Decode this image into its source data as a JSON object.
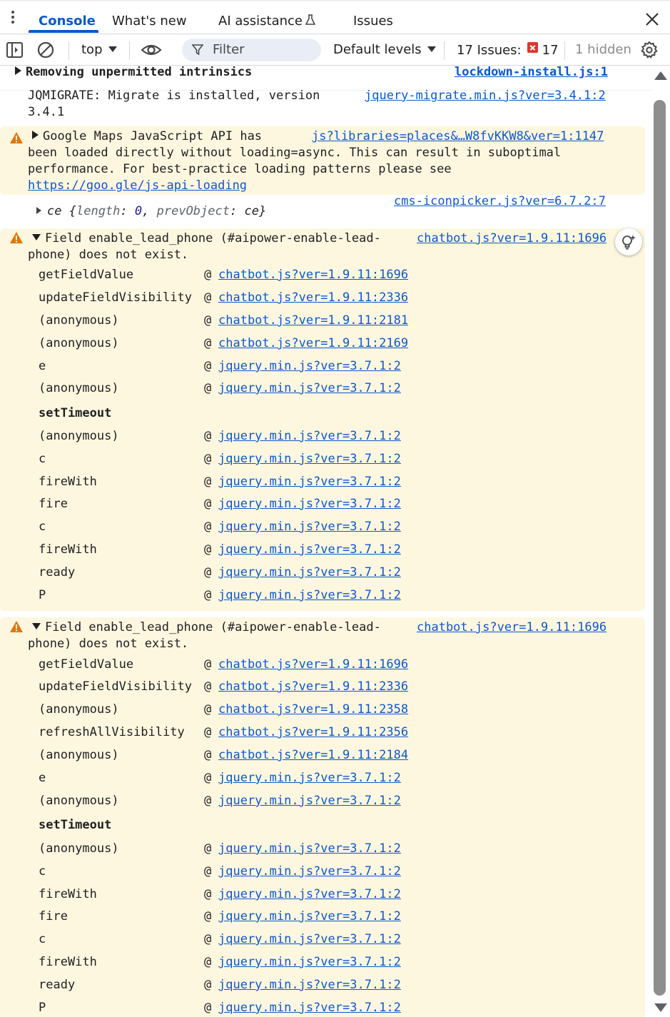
{
  "tabs": [
    {
      "label": "Console",
      "active": true
    },
    {
      "label": "What's new"
    },
    {
      "label": "AI assistance"
    },
    {
      "label": "Issues"
    }
  ],
  "toolbar": {
    "context": "top",
    "filter_placeholder": "Filter",
    "levels": "Default levels",
    "issues_label": "17 Issues:",
    "issues_count": "17",
    "hidden": "1 hidden"
  },
  "messages": {
    "m1": {
      "text": "Removing unpermitted intrinsics",
      "source": "lockdown-install.js:1"
    },
    "m2": {
      "line1": "JQMIGRATE: Migrate is installed, version",
      "line2": "3.4.1",
      "source": "jquery-migrate.min.js?ver=3.4.1:2"
    },
    "m3": {
      "line1": "Google Maps JavaScript API has",
      "line2": "been loaded directly without loading=async. This can result in suboptimal",
      "line3": "performance. For best-practice loading patterns please see",
      "link": "https://goo.gle/js-api-loading",
      "source": "js?libraries=places&…W8fvKKW8&ver=1:1147"
    },
    "m4": {
      "obj": "ce",
      "open": "{",
      "k1": "length",
      "v1": "0",
      "k2": "prevObject",
      "v2": "ce",
      "close": "}",
      "source": "cms-iconpicker.js?ver=6.7.2:7"
    },
    "m5": {
      "line1": "Field enable_lead_phone (#aipower-enable-lead-",
      "line2": "phone) does not exist.",
      "source": "chatbot.js?ver=1.9.11:1696",
      "frames_a": [
        {
          "name": "getFieldValue",
          "link": "chatbot.js?ver=1.9.11:1696"
        },
        {
          "name": "updateFieldVisibility",
          "link": "chatbot.js?ver=1.9.11:2336"
        },
        {
          "name": "(anonymous)",
          "link": "chatbot.js?ver=1.9.11:2181"
        },
        {
          "name": "(anonymous)",
          "link": "chatbot.js?ver=1.9.11:2169"
        },
        {
          "name": "e",
          "link": "jquery.min.js?ver=3.7.1:2"
        },
        {
          "name": "(anonymous)",
          "link": "jquery.min.js?ver=3.7.1:2"
        }
      ],
      "async_label": "setTimeout",
      "frames_b": [
        {
          "name": "(anonymous)",
          "link": "jquery.min.js?ver=3.7.1:2"
        },
        {
          "name": "c",
          "link": "jquery.min.js?ver=3.7.1:2"
        },
        {
          "name": "fireWith",
          "link": "jquery.min.js?ver=3.7.1:2"
        },
        {
          "name": "fire",
          "link": "jquery.min.js?ver=3.7.1:2"
        },
        {
          "name": "c",
          "link": "jquery.min.js?ver=3.7.1:2"
        },
        {
          "name": "fireWith",
          "link": "jquery.min.js?ver=3.7.1:2"
        },
        {
          "name": "ready",
          "link": "jquery.min.js?ver=3.7.1:2"
        },
        {
          "name": "P",
          "link": "jquery.min.js?ver=3.7.1:2"
        }
      ]
    },
    "m6": {
      "line1": "Field enable_lead_phone (#aipower-enable-lead-",
      "line2": "phone) does not exist.",
      "source": "chatbot.js?ver=1.9.11:1696",
      "frames_a": [
        {
          "name": "getFieldValue",
          "link": "chatbot.js?ver=1.9.11:1696"
        },
        {
          "name": "updateFieldVisibility",
          "link": "chatbot.js?ver=1.9.11:2336"
        },
        {
          "name": "(anonymous)",
          "link": "chatbot.js?ver=1.9.11:2358"
        },
        {
          "name": "refreshAllVisibility",
          "link": "chatbot.js?ver=1.9.11:2356"
        },
        {
          "name": "(anonymous)",
          "link": "chatbot.js?ver=1.9.11:2184"
        },
        {
          "name": "e",
          "link": "jquery.min.js?ver=3.7.1:2"
        },
        {
          "name": "(anonymous)",
          "link": "jquery.min.js?ver=3.7.1:2"
        }
      ],
      "async_label": "setTimeout",
      "frames_b": [
        {
          "name": "(anonymous)",
          "link": "jquery.min.js?ver=3.7.1:2"
        },
        {
          "name": "c",
          "link": "jquery.min.js?ver=3.7.1:2"
        },
        {
          "name": "fireWith",
          "link": "jquery.min.js?ver=3.7.1:2"
        },
        {
          "name": "fire",
          "link": "jquery.min.js?ver=3.7.1:2"
        },
        {
          "name": "c",
          "link": "jquery.min.js?ver=3.7.1:2"
        },
        {
          "name": "fireWith",
          "link": "jquery.min.js?ver=3.7.1:2"
        },
        {
          "name": "ready",
          "link": "jquery.min.js?ver=3.7.1:2"
        },
        {
          "name": "P",
          "link": "jquery.min.js?ver=3.7.1:2"
        }
      ]
    }
  },
  "colors": {
    "accent": "#0b57d0",
    "warning_bg": "#fef7e0",
    "warning_icon": "#e37400",
    "error_badge": "#dc362e"
  }
}
